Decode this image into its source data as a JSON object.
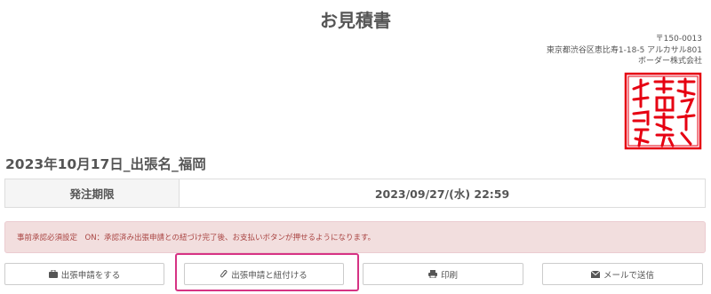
{
  "document": {
    "title": "お見積書",
    "corner_mark": "··· ·· ·"
  },
  "issuer": {
    "postal_code": "〒150-0013",
    "address": "東京都渋谷区恵比寿1-18-5 アルカサル801",
    "company": "ボーダー株式会社"
  },
  "seal": {
    "icon": "company-seal-stamp",
    "color": "#e60012",
    "text": "ボーダー株式会社之印"
  },
  "trip": {
    "title": "2023年10月17日_出張名_福岡"
  },
  "deadline": {
    "label": "発注期限",
    "value": "2023/09/27/(水) 22:59"
  },
  "alert": {
    "text": "事前承認必須設定　ON：承認済み出張申請との紐づけ完了後、お支払いボタンが押せるようになります。",
    "color": "#a94442",
    "background": "#f2dede"
  },
  "actions": {
    "apply": {
      "label": "出張申請をする",
      "icon": "briefcase-icon"
    },
    "link": {
      "label": "出張申請と紐付ける",
      "icon": "paperclip-icon"
    },
    "print": {
      "label": "印刷",
      "icon": "printer-icon"
    },
    "mail": {
      "label": "メールで送信",
      "icon": "envelope-icon"
    }
  },
  "highlight_color": "#d63384"
}
